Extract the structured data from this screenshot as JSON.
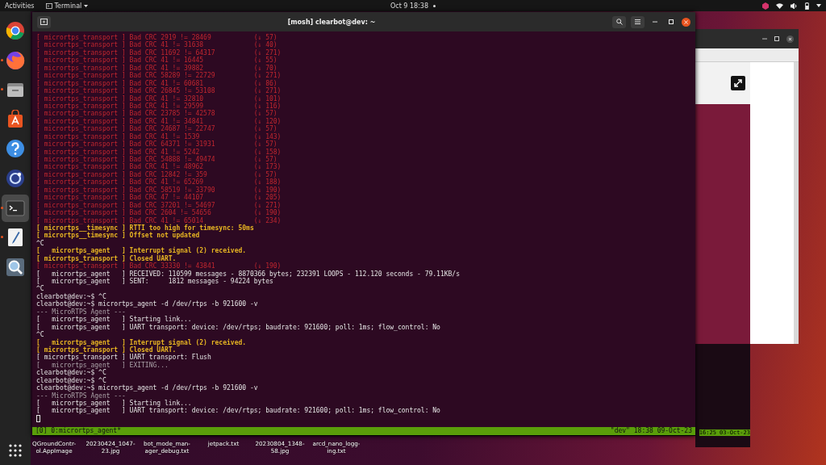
{
  "top_bar": {
    "activities": "Activities",
    "app_menu": "Terminal",
    "clock": "Oct 9  18:38"
  },
  "dock": {
    "items": [
      {
        "kind": "chrome",
        "running": false,
        "selected": false
      },
      {
        "kind": "firefox",
        "running": true,
        "selected": false
      },
      {
        "kind": "files",
        "running": true,
        "selected": false
      },
      {
        "kind": "software",
        "running": false,
        "selected": false
      },
      {
        "kind": "help",
        "running": false,
        "selected": false
      },
      {
        "kind": "app",
        "running": false,
        "selected": false
      },
      {
        "kind": "terminal",
        "running": true,
        "selected": true
      },
      {
        "kind": "editor",
        "running": true,
        "selected": false
      },
      {
        "kind": "viewer",
        "running": false,
        "selected": false
      }
    ]
  },
  "terminal": {
    "title": "[mosh] clearbot@dev: ~",
    "lines": [
      {
        "kind": "error",
        "text": "[ micrortps_transport ] Bad CRC 2919 != 28469",
        "note": "(↓ 57)"
      },
      {
        "kind": "error",
        "text": "[ micrortps_transport ] Bad CRC 41 != 31638",
        "note": "(↓ 40)"
      },
      {
        "kind": "error",
        "text": "[ micrortps_transport ] Bad CRC 11692 != 64317",
        "note": "(↓ 271)"
      },
      {
        "kind": "error",
        "text": "[ micrortps_transport ] Bad CRC 41 != 16445",
        "note": "(↓ 55)"
      },
      {
        "kind": "error",
        "text": "[ micrortps_transport ] Bad CRC 41 != 39882",
        "note": "(↓ 70)"
      },
      {
        "kind": "error",
        "text": "[ micrortps_transport ] Bad CRC 58289 != 22729",
        "note": "(↓ 271)"
      },
      {
        "kind": "error",
        "text": "[ micrortps_transport ] Bad CRC 41 != 60681",
        "note": "(↓ 86)"
      },
      {
        "kind": "error",
        "text": "[ micrortps_transport ] Bad CRC 26845 != 53108",
        "note": "(↓ 271)"
      },
      {
        "kind": "error",
        "text": "[ micrortps_transport ] Bad CRC 41 != 32810",
        "note": "(↓ 101)"
      },
      {
        "kind": "error",
        "text": "[ micrortps_transport ] Bad CRC 41 != 29599",
        "note": "(↓ 116)"
      },
      {
        "kind": "error",
        "text": "[ micrortps_transport ] Bad CRC 23785 != 42578",
        "note": "(↓ 57)"
      },
      {
        "kind": "error",
        "text": "[ micrortps_transport ] Bad CRC 41 != 34841",
        "note": "(↓ 120)"
      },
      {
        "kind": "error",
        "text": "[ micrortps_transport ] Bad CRC 24687 != 22747",
        "note": "(↓ 57)"
      },
      {
        "kind": "error",
        "text": "[ micrortps_transport ] Bad CRC 41 != 1539",
        "note": "(↓ 143)"
      },
      {
        "kind": "error",
        "text": "[ micrortps_transport ] Bad CRC 64371 != 31931",
        "note": "(↓ 57)"
      },
      {
        "kind": "error",
        "text": "[ micrortps_transport ] Bad CRC 41 != 5242",
        "note": "(↓ 158)"
      },
      {
        "kind": "error",
        "text": "[ micrortps_transport ] Bad CRC 54888 != 49474",
        "note": "(↓ 57)"
      },
      {
        "kind": "error",
        "text": "[ micrortps_transport ] Bad CRC 41 != 48962",
        "note": "(↓ 173)"
      },
      {
        "kind": "error",
        "text": "[ micrortps_transport ] Bad CRC 12842 != 359",
        "note": "(↓ 57)"
      },
      {
        "kind": "error",
        "text": "[ micrortps_transport ] Bad CRC 41 != 65269",
        "note": "(↓ 188)"
      },
      {
        "kind": "error",
        "text": "[ micrortps_transport ] Bad CRC 58519 != 33790",
        "note": "(↓ 190)"
      },
      {
        "kind": "error",
        "text": "[ micrortps_transport ] Bad CRC 47 != 44107",
        "note": "(↓ 205)"
      },
      {
        "kind": "error",
        "text": "[ micrortps_transport ] Bad CRC 37201 != 54697",
        "note": "(↓ 271)"
      },
      {
        "kind": "error",
        "text": "[ micrortps_transport ] Bad CRC 2604 != 54656",
        "note": "(↓ 190)"
      },
      {
        "kind": "error",
        "text": "[ micrortps_transport ] Bad CRC 41 != 65014",
        "note": "(↓ 234)"
      },
      {
        "kind": "warn",
        "text": "[ micrortps__timesync ] RTTI too high for timesync: 50ms"
      },
      {
        "kind": "warn",
        "text": "[ micrortps__timesync ] Offset not updated"
      },
      {
        "kind": "plain",
        "text": "^C"
      },
      {
        "kind": "warn",
        "text": "[   micrortps_agent   ] Interrupt signal (2) received."
      },
      {
        "kind": "warn",
        "text": "[ micrortps_transport ] Closed UART."
      },
      {
        "kind": "error",
        "text": "[ micrortps_transport ] Bad CRC 33330 != 43841",
        "note": "(↓ 190)"
      },
      {
        "kind": "plain",
        "text": "[   micrortps_agent   ] RECEIVED: 110599 messages - 8870366 bytes; 232391 LOOPS - 112.120 seconds - 79.11KB/s"
      },
      {
        "kind": "plain",
        "text": "[   micrortps_agent   ] SENT:     1812 messages - 94224 bytes"
      },
      {
        "kind": "plain",
        "text": "^C"
      },
      {
        "kind": "plain",
        "text": "clearbot@dev:~$ ^C"
      },
      {
        "kind": "plain",
        "text": "clearbot@dev:~$ micrortps_agent -d /dev/rtps -b 921600 -v"
      },
      {
        "kind": "dim",
        "text": "--- MicroRTPS Agent ---"
      },
      {
        "kind": "plain",
        "text": "[   micrortps_agent   ] Starting link..."
      },
      {
        "kind": "plain",
        "text": "[   micrortps_agent   ] UART transport: device: /dev/rtps; baudrate: 921600; poll: 1ms; flow_control: No"
      },
      {
        "kind": "plain",
        "text": "^C"
      },
      {
        "kind": "warn",
        "text": "[   micrortps_agent   ] Interrupt signal (2) received."
      },
      {
        "kind": "warn",
        "text": "[ micrortps_transport ] Closed UART."
      },
      {
        "kind": "plain",
        "text": "[ micrortps_transport ] UART transport: Flush"
      },
      {
        "kind": "dim",
        "text": "[   micrortps_agent   ] EXITING..."
      },
      {
        "kind": "plain",
        "text": "clearbot@dev:~$ ^C"
      },
      {
        "kind": "plain",
        "text": "clearbot@dev:~$ ^C"
      },
      {
        "kind": "plain",
        "text": "clearbot@dev:~$ micrortps_agent -d /dev/rtps -b 921600 -v"
      },
      {
        "kind": "dim",
        "text": "--- MicroRTPS Agent ---"
      },
      {
        "kind": "plain",
        "text": "[   micrortps_agent   ] Starting link..."
      },
      {
        "kind": "plain",
        "text": "[   micrortps_agent   ] UART transport: device: /dev/rtps; baudrate: 921600; poll: 1ms; flow_control: No"
      },
      {
        "kind": "cursor"
      }
    ],
    "status_left": "[0] 0:micrortps_agent*",
    "status_right": "\"dev\" 18:38 09-Oct-23"
  },
  "background_window": {
    "status": "16:25 03-Oct-23"
  },
  "desktop_files": [
    {
      "lines": [
        "QGroundContr-",
        "ol.AppImage"
      ]
    },
    {
      "lines": [
        "20230424_1047-",
        "23.jpg"
      ]
    },
    {
      "lines": [
        "bot_mode_man-",
        "ager_debug.txt"
      ]
    },
    {
      "lines": [
        "jetpack.txt"
      ]
    },
    {
      "lines": [
        "20230804_1348-",
        "58.jpg"
      ]
    },
    {
      "lines": [
        "arcd_nano_logg-",
        "ing.txt"
      ]
    }
  ]
}
